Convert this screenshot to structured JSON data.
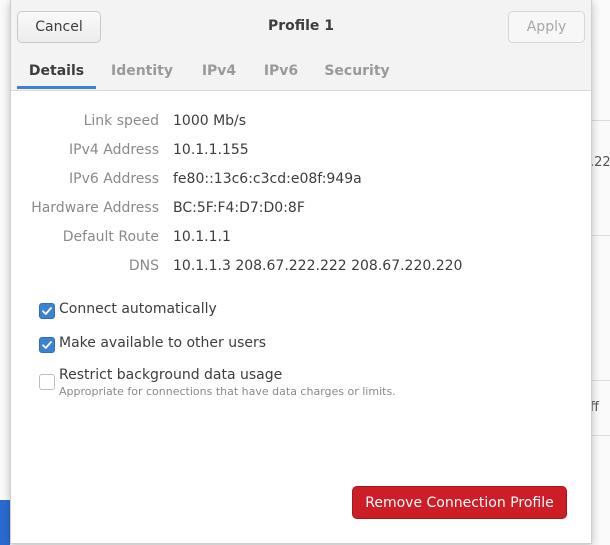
{
  "background": {
    "partial_text_1": ".22",
    "partial_text_2": "ff"
  },
  "dialog": {
    "title": "Profile 1",
    "cancel_label": "Cancel",
    "apply_label": "Apply"
  },
  "tabs": [
    {
      "label": "Details",
      "active": true
    },
    {
      "label": "Identity",
      "active": false
    },
    {
      "label": "IPv4",
      "active": false
    },
    {
      "label": "IPv6",
      "active": false
    },
    {
      "label": "Security",
      "active": false
    }
  ],
  "details": [
    {
      "label": "Link speed",
      "value": "1000 Mb/s"
    },
    {
      "label": "IPv4 Address",
      "value": "10.1.1.155"
    },
    {
      "label": "IPv6 Address",
      "value": "fe80::13c6:c3cd:e08f:949a"
    },
    {
      "label": "Hardware Address",
      "value": "BC:5F:F4:D7:D0:8F"
    },
    {
      "label": "Default Route",
      "value": "10.1.1.1"
    },
    {
      "label": "DNS",
      "value": "10.1.1.3 208.67.222.222 208.67.220.220"
    }
  ],
  "options": {
    "connect_automatically": {
      "label": "Connect automatically",
      "checked": true
    },
    "available_to_others": {
      "label": "Make available to other users",
      "checked": true
    },
    "restrict_background": {
      "label": "Restrict background data usage",
      "sublabel": "Appropriate for connections that have data charges or limits.",
      "checked": false
    }
  },
  "remove_label": "Remove Connection Profile",
  "colors": {
    "accent": "#3b83d1",
    "destructive": "#cd1d26"
  }
}
